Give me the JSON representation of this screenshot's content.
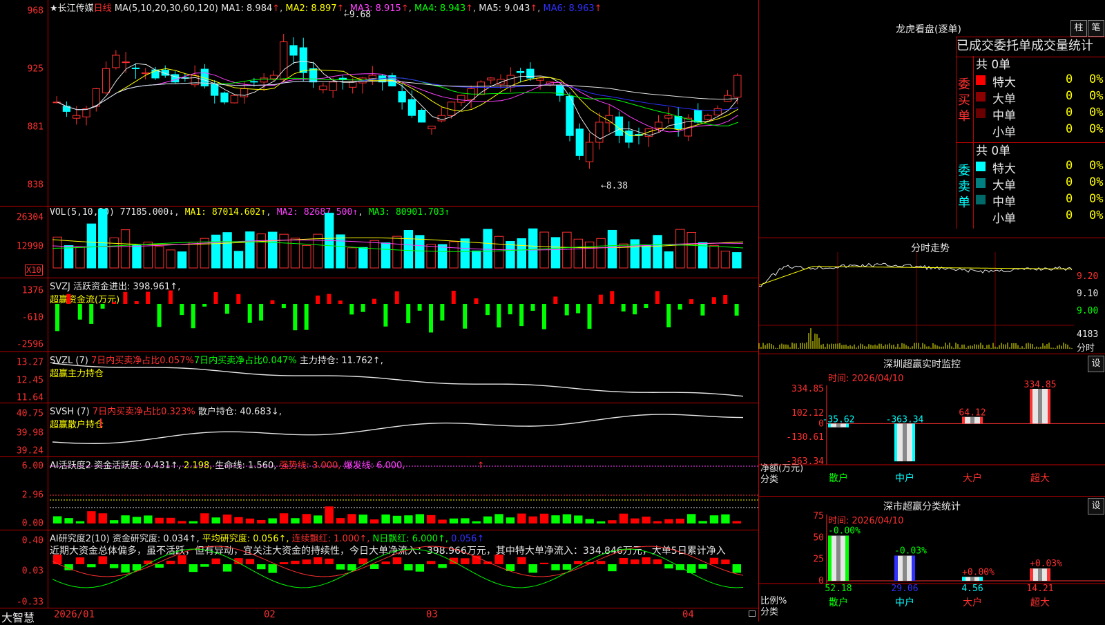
{
  "stock": {
    "star": "★",
    "name": "长江传媒",
    "period": "日线"
  },
  "kline": {
    "ma_label": "MA(5,10,20,30,60,120)",
    "ma1": "MA1: 8.984",
    "ma2": "MA2: 8.897",
    "ma3": "MA3: 8.915",
    "ma4": "MA4: 8.943",
    "ma5": "MA5: 9.043",
    "ma6": "MA6: 8.963",
    "up_arrow": "↑",
    "yticks": [
      "968",
      "925",
      "881",
      "838"
    ],
    "high_label": "9.68",
    "low_label": "8.38"
  },
  "volume": {
    "label": "VOL(5,10,20)",
    "value": "77185.000↓",
    "ma1": "MA1: 87014.602↑",
    "ma2": "MA2: 82687.500↑",
    "ma3": "MA3: 80901.703↑",
    "yticks": [
      "26304",
      "12990"
    ],
    "unit": "X10"
  },
  "svzj": {
    "label": "SVZJ",
    "active": "活跃资金进出: 398.961↑,",
    "sub": "超赢资金流(万元)",
    "yticks": [
      "1376",
      "-610",
      "-2596"
    ]
  },
  "svzl": {
    "label": "SVZL (7)",
    "a": "7日内买卖净占比0.057%",
    "b": "7日内买卖净占比0.047%",
    "c": "主力持仓: 11.762↑,",
    "sub": "超赢主力持仓",
    "yticks": [
      "13.27",
      "12.45",
      "11.64"
    ]
  },
  "svsh": {
    "label": "SVSH (7)",
    "a": "7日内买卖净占比0.323%",
    "c": "散户持仓: 40.683↓,",
    "sub": "超赢散户持仓",
    "yticks": [
      "40.75",
      "39.98",
      "39.24"
    ]
  },
  "ai1": {
    "label": "AI活跃度2",
    "a": "资金活跃度: 0.431↑,",
    "b": "2.198,",
    "c": "生命线: 1.560,",
    "d": "强势线: 3.000,",
    "e": "爆发线: 6.000,",
    "f": "↑",
    "yticks": [
      "6.00",
      "2.96",
      "0.00"
    ]
  },
  "ai2": {
    "label": "AI研究度2(10)",
    "a": "资金研究度: 0.034↑,",
    "b": "平均研究度: 0.056↑,",
    "c": "连续飘红: 1.000↑,",
    "d": "N日飘红: 6.000↑,",
    "e": "0.056↑",
    "comment": "近期大资金总体偏多，虽不活跃，但有异动，宜关注大资金的持续性，今日大单净流入：398.966万元，其中特大单净流入：334.846万元，大单5日累计净入",
    "yticks": [
      "0.40",
      "0.03",
      "-0.33"
    ]
  },
  "xaxis": {
    "brand": "大智慧",
    "labels": [
      "2026/01",
      "02",
      "03",
      "04"
    ]
  },
  "dragon": {
    "title": "龙虎看盘(逐单)",
    "btn1": "柱",
    "btn2": "笔",
    "tabs": "已成交委托单成交量统计",
    "buy_label": "委买单",
    "sell_label": "委卖单",
    "total": "共 0单",
    "rows": [
      "特大",
      "大单",
      "中单",
      "小单"
    ],
    "qty": "0",
    "pct": "0%"
  },
  "intraday": {
    "title": "分时走势",
    "yticks": [
      "9.20",
      "9.10",
      "9.00"
    ],
    "vol_max": "4183",
    "vol_label": "分时"
  },
  "sz_monitor": {
    "title": "深圳超赢实时监控",
    "btn": "设",
    "time": "时间: 2026/04/10",
    "yticks": [
      "334.85",
      "102.12",
      "0",
      "-130.61",
      "-363.34"
    ],
    "ylab1": "净额(万元)",
    "ylab2": "分类",
    "cats": [
      "散户",
      "中户",
      "大户",
      "超大"
    ],
    "values": [
      "-35.62",
      "-363.34",
      "64.12",
      "334.85"
    ]
  },
  "sz_stats": {
    "title": "深市超赢分类统计",
    "btn": "设",
    "time": "时间: 2026/04/10",
    "yticks": [
      "75",
      "50",
      "25",
      "0"
    ],
    "ylab1": "比例%",
    "ylab2": "分类",
    "cats": [
      "散户",
      "中户",
      "大户",
      "超大"
    ],
    "values": [
      "52.18",
      "29.06",
      "4.56",
      "14.21"
    ],
    "changes": [
      "-0.00%",
      "-0.03%",
      "+0.00%",
      "+0.03%"
    ]
  },
  "chart_data": {
    "type": "bar",
    "title": "深圳超赢实时监控",
    "categories": [
      "散户",
      "中户",
      "大户",
      "超大"
    ],
    "series": [
      {
        "name": "净额(万元)",
        "values": [
          -35.62,
          -363.34,
          64.12,
          334.85
        ]
      }
    ],
    "ylabel": "净额(万元)",
    "ylim": [
      -363.34,
      334.85
    ]
  }
}
